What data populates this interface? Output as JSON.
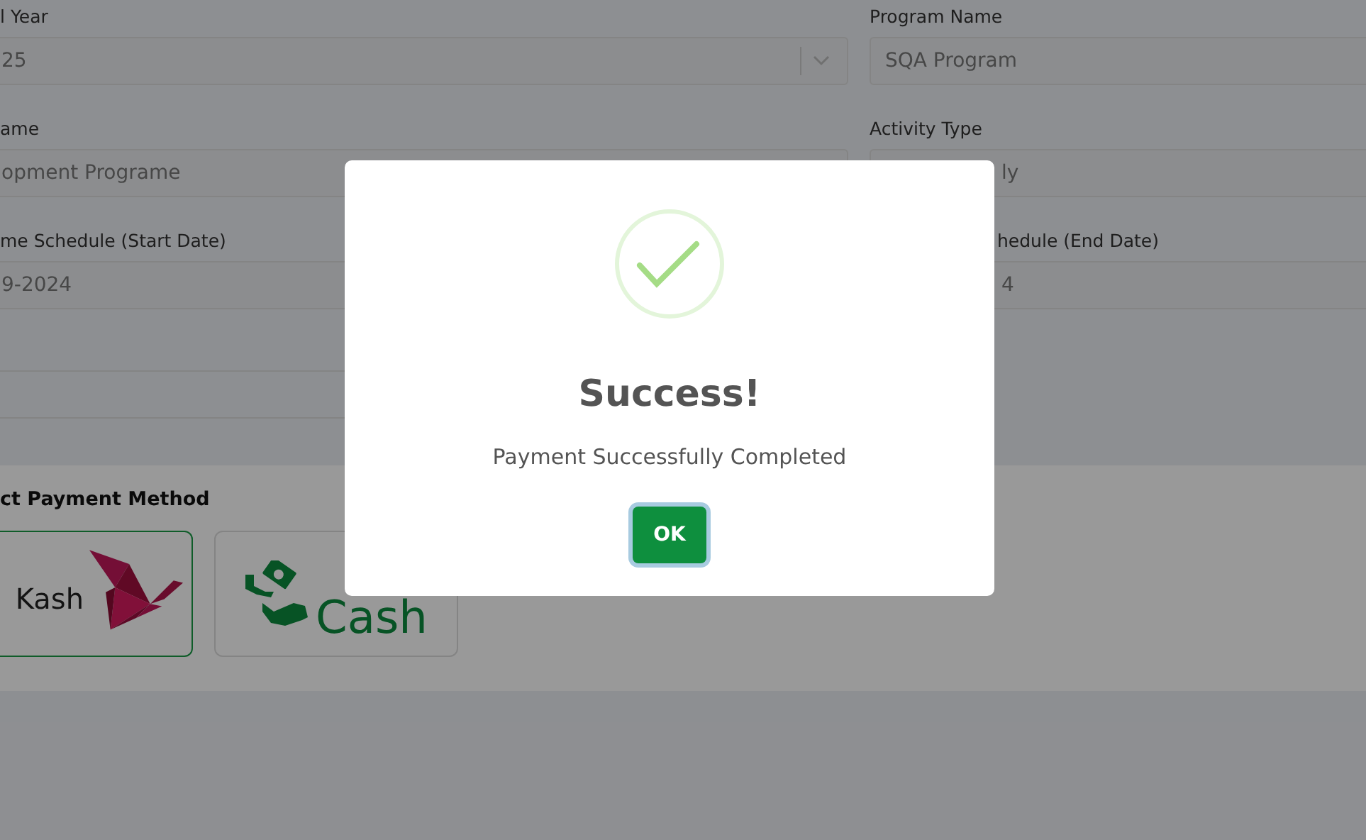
{
  "form": {
    "left": [
      {
        "label": "l Year",
        "value": "25",
        "kind": "select"
      },
      {
        "label": "ame",
        "value": "opment Programe",
        "kind": "text"
      },
      {
        "label": "me Schedule (Start Date)",
        "value": "9-2024",
        "kind": "text"
      },
      {
        "kind": "blank"
      }
    ],
    "right": [
      {
        "label": "Program Name",
        "value": "SQA Program",
        "covered": false
      },
      {
        "label": "Activity Type",
        "value": "ly",
        "covered": true
      },
      {
        "label": "hedule (End Date)",
        "value": "4",
        "covered": true
      }
    ]
  },
  "payment": {
    "heading": "ct Payment Method",
    "methods": [
      {
        "kind": "bkash",
        "label": "Kash",
        "selected": true
      },
      {
        "kind": "cash",
        "label": "Cash",
        "selected": false
      }
    ]
  },
  "dialog": {
    "title": "Success!",
    "message": "Payment Successfully Completed",
    "button": "OK"
  }
}
